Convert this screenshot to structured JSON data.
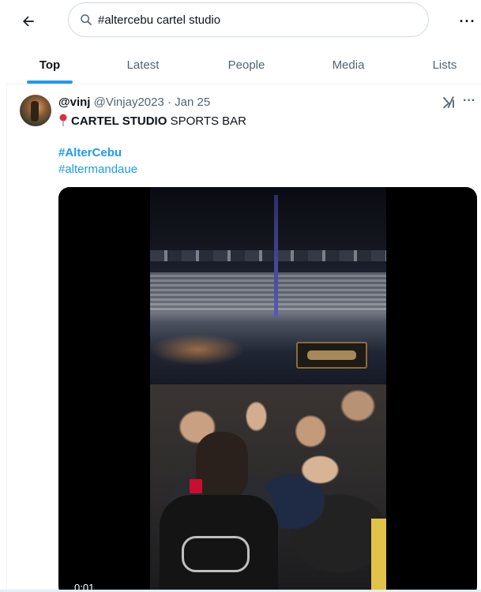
{
  "header": {
    "back_icon": "arrow-left-icon",
    "search": {
      "icon": "search-icon",
      "value": "#altercebu cartel studio",
      "placeholder": "Search"
    },
    "more_label": "···"
  },
  "tabs": [
    {
      "label": "Top",
      "active": true
    },
    {
      "label": "Latest",
      "active": false
    },
    {
      "label": "People",
      "active": false
    },
    {
      "label": "Media",
      "active": false
    },
    {
      "label": "Lists",
      "active": false
    }
  ],
  "tweet": {
    "display_name": "@vinj",
    "handle": "@Vinjay2023",
    "separator": "·",
    "date": "Jan 25",
    "more_label": "···",
    "grok_icon": "grok-icon",
    "pin_icon": "round-pushpin-icon",
    "text_bold": "CARTEL STUDIO",
    "text_rest": " SPORTS BAR",
    "hashtag_1": "#AlterCebu",
    "hashtag_2": "#altermandaue",
    "media": {
      "type": "video",
      "timestamp": "0:01"
    }
  },
  "colors": {
    "accent": "#1d9bf0",
    "text_primary": "#0f1419",
    "text_secondary": "#536471",
    "border": "#cfd9de"
  }
}
